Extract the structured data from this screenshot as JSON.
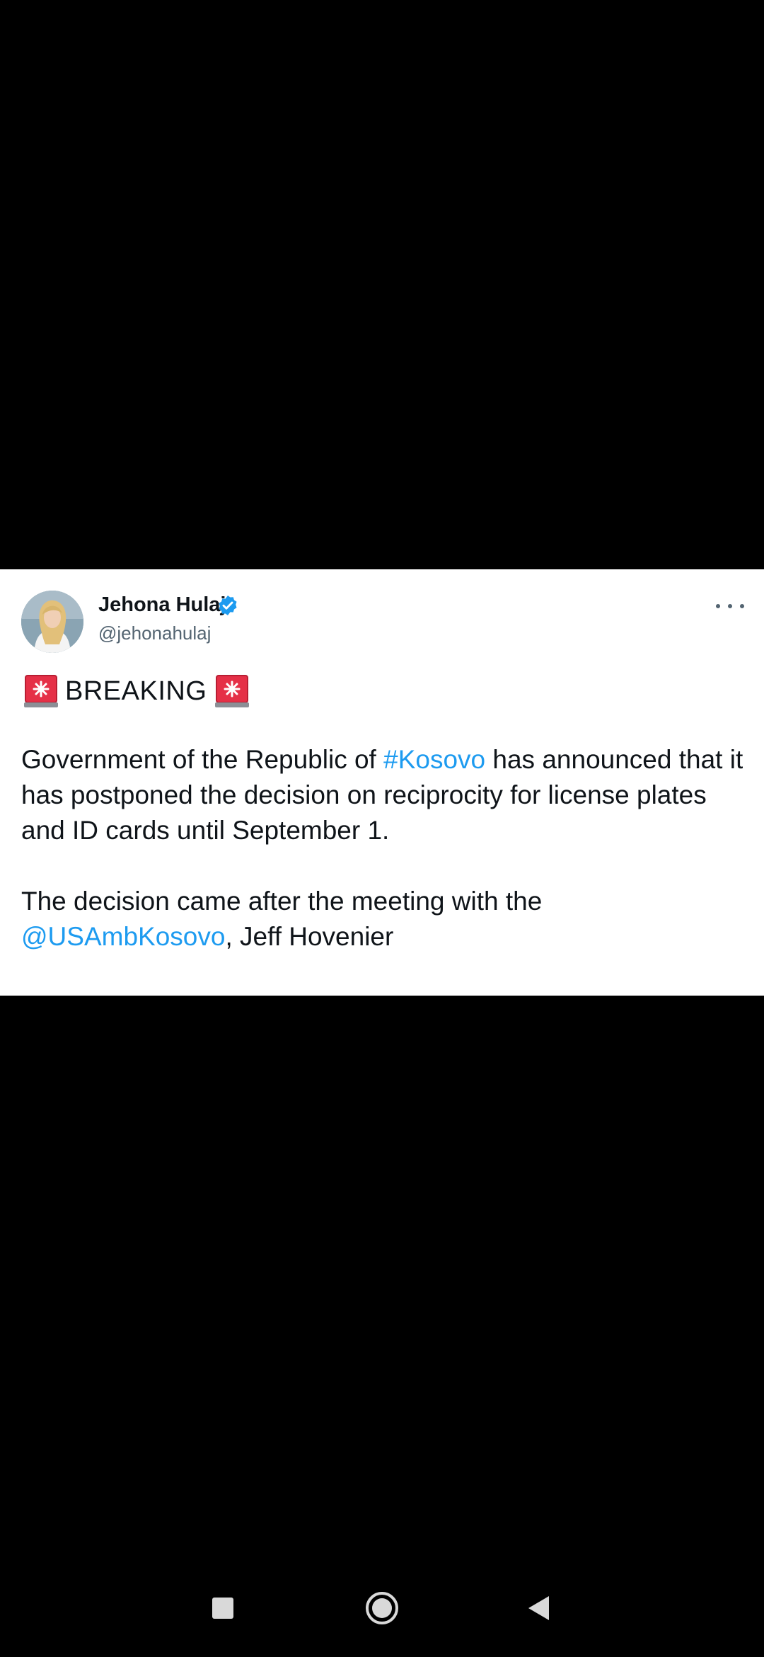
{
  "tweet": {
    "author_name": "Jehona Hulaj",
    "handle": "@jehonahulaj",
    "verified": true,
    "headline": "BREAKING",
    "headline_icon": "police-siren-emoji",
    "body": {
      "p1_before": "Government of the Republic of ",
      "hashtag": "#Kosovo",
      "p1_after": " has announced that it has postponed the decision on reciprocity for license plates and ID cards until September 1.",
      "p2_before": "The decision came after the meeting with the ",
      "mention": "@USAmbKosovo",
      "p2_after": ", Jeff Hovenier"
    },
    "more_icon": "more-options-icon"
  },
  "colors": {
    "text": "#0f1419",
    "secondary": "#536471",
    "link": "#1d9bf0",
    "verified": "#1d9bf0",
    "background": "#000000",
    "card": "#ffffff"
  },
  "nav": {
    "recents_icon": "square-icon",
    "home_icon": "circle-home-icon",
    "back_icon": "triangle-back-icon"
  }
}
